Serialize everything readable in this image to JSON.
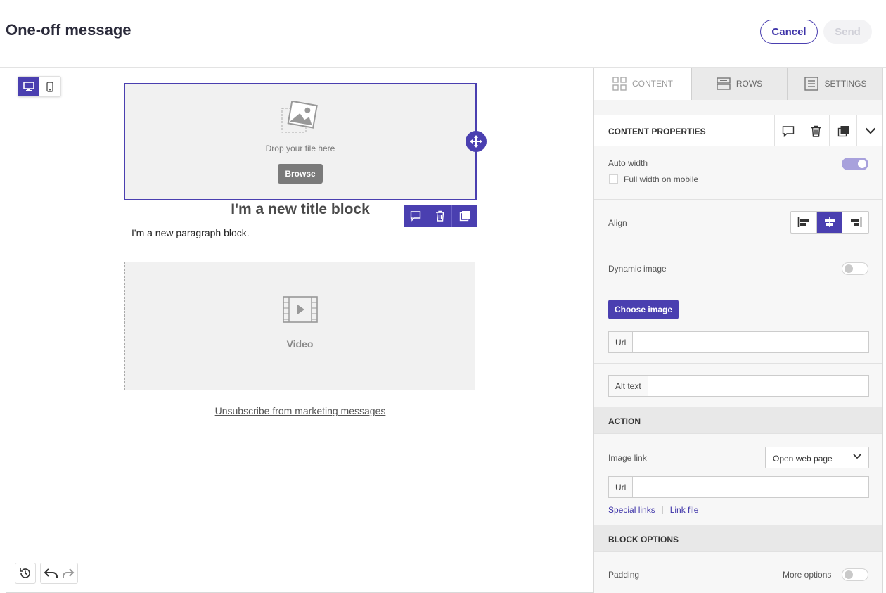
{
  "header": {
    "title": "One-off message",
    "cancel_label": "Cancel",
    "send_label": "Send"
  },
  "canvas": {
    "image_block": {
      "drop_text": "Drop your file here",
      "browse_label": "Browse"
    },
    "title_block": "I'm a new title block",
    "paragraph_block": "I'm a new paragraph block.",
    "video_block": {
      "label": "Video"
    },
    "unsubscribe_link": "Unsubscribe from marketing messages"
  },
  "panel": {
    "tabs": [
      {
        "label": "CONTENT",
        "icon": "grid-icon",
        "active": true
      },
      {
        "label": "ROWS",
        "icon": "rows-icon",
        "active": false
      },
      {
        "label": "SETTINGS",
        "icon": "settings-icon",
        "active": false
      }
    ],
    "content_properties_title": "CONTENT PROPERTIES",
    "auto_width_label": "Auto width",
    "full_width_mobile_label": "Full width on mobile",
    "align_label": "Align",
    "dynamic_image_label": "Dynamic image",
    "choose_image_label": "Choose image",
    "url_label": "Url",
    "alt_text_label": "Alt text",
    "action_heading": "ACTION",
    "image_link_label": "Image link",
    "image_link_value": "Open web page",
    "link_url_label": "Url",
    "special_links_label": "Special links",
    "link_file_label": "Link file",
    "block_options_heading": "BLOCK OPTIONS",
    "padding_label": "Padding",
    "more_options_label": "More options"
  },
  "colors": {
    "accent": "#4a3fb0"
  }
}
